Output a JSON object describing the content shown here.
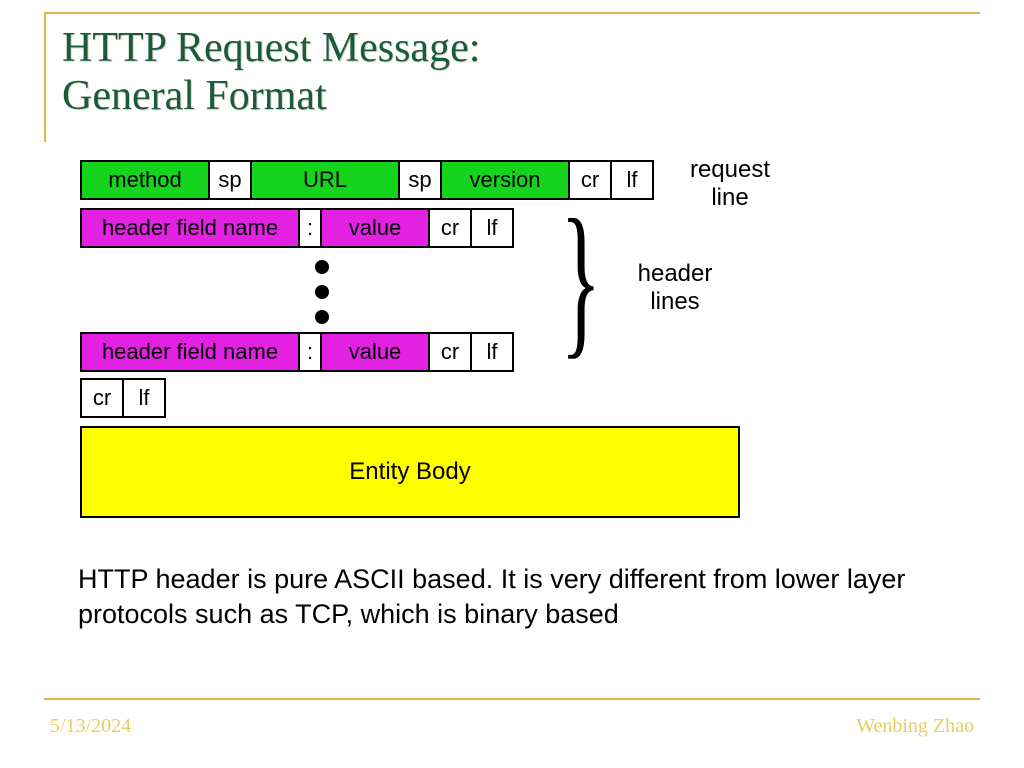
{
  "title_line1": "HTTP Request Message:",
  "title_line2": "General Format",
  "request_row": {
    "method": "method",
    "sp1": "sp",
    "url": "URL",
    "sp2": "sp",
    "version": "version",
    "cr": "cr",
    "lf": "lf"
  },
  "header_row": {
    "name": "header field name",
    "colon": ":",
    "value": "value",
    "cr": "cr",
    "lf": "lf"
  },
  "blank_row": {
    "cr": "cr",
    "lf": "lf"
  },
  "entity_body": "Entity Body",
  "labels": {
    "request_line": "request\nline",
    "header_lines": "header\nlines"
  },
  "footnote": "HTTP header is pure ASCII based. It is very different from lower layer protocols such as TCP, which is binary based",
  "date": "5/13/2024",
  "author": "Wenbing Zhao",
  "colors": {
    "green": "#14d41e",
    "magenta": "#e321e3",
    "yellow": "#ffff00",
    "accent_rule": "#d9b84b",
    "title_green": "#1b5a3a"
  }
}
